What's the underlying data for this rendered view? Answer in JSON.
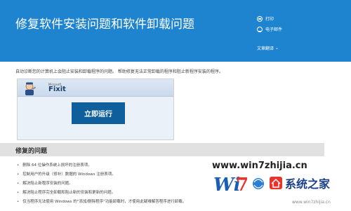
{
  "header": {
    "title": "修复软件安装问题和软件卸载问题",
    "actions": [
      {
        "label": "打印",
        "icon": "print-icon"
      },
      {
        "label": "电子邮件",
        "icon": "mail-icon"
      }
    ],
    "translate_label": "文章翻译",
    "translate_icon": "chevron-down-icon"
  },
  "intro_text": "自动诊断您的计算机上会阻止安装和卸载程序的问题。 帮助修复无法正常卸载的程序和阻止新程序安装的程序。",
  "fixit": {
    "brand_small": "Microsoft",
    "brand": "Fixit",
    "run_label": "立即运行"
  },
  "issues": {
    "title": "修复的问题",
    "items": [
      "删除 64 位操作系统上损坏的注册表项。",
      "控制用户的升级（修补）数据的 Windows 注册表项。",
      "解决阻止新程序安装的问题。",
      "解决阻止程序完全卸载和阻止新的安装和更新的问题。",
      "仅当程序无法使用 Windows 的\"添加/删除程序\"功能卸载时，才使用此疑难解答程序进行卸载。"
    ]
  },
  "watermark": {
    "url_text": "www.win7zhijia.cn",
    "logo_text": "系统之家",
    "sub_text": "www.win7zhijia.cn"
  },
  "colors": {
    "header_bg": "#1f84d0",
    "run_button": "#0f5f9c",
    "section_bar": "#e1e1e1",
    "watermark_red": "#e8342a",
    "watermark_blue": "#1a5db5"
  }
}
